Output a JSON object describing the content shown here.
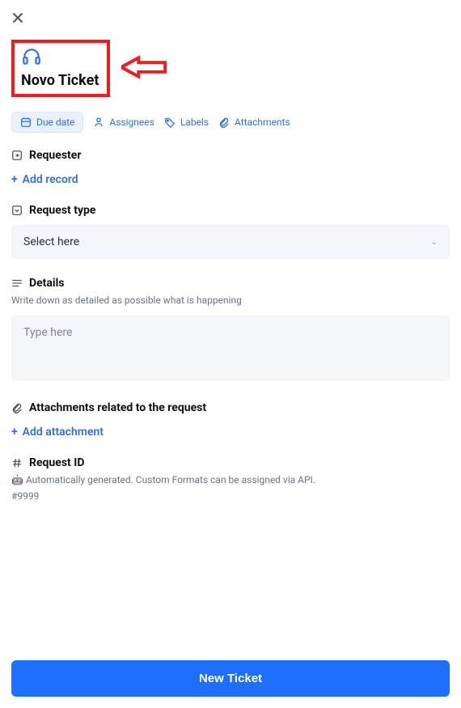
{
  "title": "Novo Ticket",
  "chips": {
    "due_date": "Due date",
    "assignees": "Assignees",
    "labels": "Labels",
    "attachments": "Attachments"
  },
  "requester": {
    "title": "Requester",
    "add_label": "Add record"
  },
  "request_type": {
    "title": "Request type",
    "placeholder": "Select here"
  },
  "details": {
    "title": "Details",
    "helper": "Write down as detailed as possible what is happening",
    "placeholder": "Type here"
  },
  "request_attachments": {
    "title": "Attachments related to the request",
    "add_label": "Add attachment"
  },
  "request_id": {
    "title": "Request ID",
    "helper": "🤖 Automatically generated. Custom Formats can be assigned via API.",
    "value": "#9999"
  },
  "submit_label": "New Ticket"
}
